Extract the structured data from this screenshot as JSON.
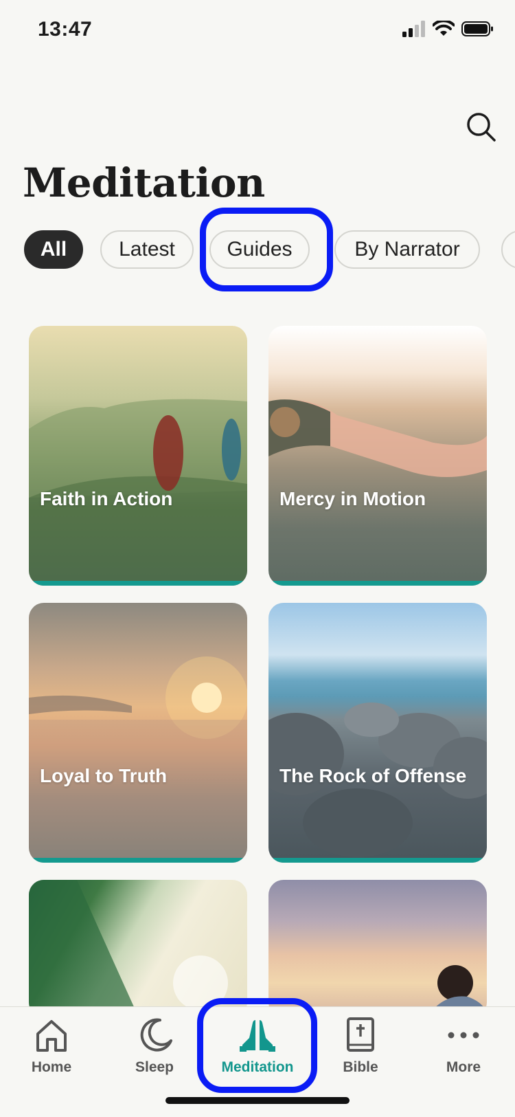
{
  "status_bar": {
    "time": "13:47"
  },
  "header": {
    "title": "Meditation"
  },
  "filters": [
    {
      "label": "All",
      "active": true
    },
    {
      "label": "Latest",
      "active": false
    },
    {
      "label": "Guides",
      "active": false
    },
    {
      "label": "By Narrator",
      "active": false
    }
  ],
  "cards": [
    {
      "title": "Faith in Action"
    },
    {
      "title": "Mercy in Motion"
    },
    {
      "title": "Loyal to Truth"
    },
    {
      "title": "The Rock of Offense"
    },
    {
      "title": ""
    },
    {
      "title": ""
    }
  ],
  "tabbar": {
    "items": [
      {
        "label": "Home",
        "icon": "home-icon"
      },
      {
        "label": "Sleep",
        "icon": "moon-icon"
      },
      {
        "label": "Meditation",
        "icon": "praying-hands-icon",
        "active": true
      },
      {
        "label": "Bible",
        "icon": "bible-icon"
      },
      {
        "label": "More",
        "icon": "more-dots-icon"
      }
    ]
  },
  "colors": {
    "accent": "#149a8f",
    "highlight": "#0a1cf5",
    "background": "#f7f7f4"
  }
}
